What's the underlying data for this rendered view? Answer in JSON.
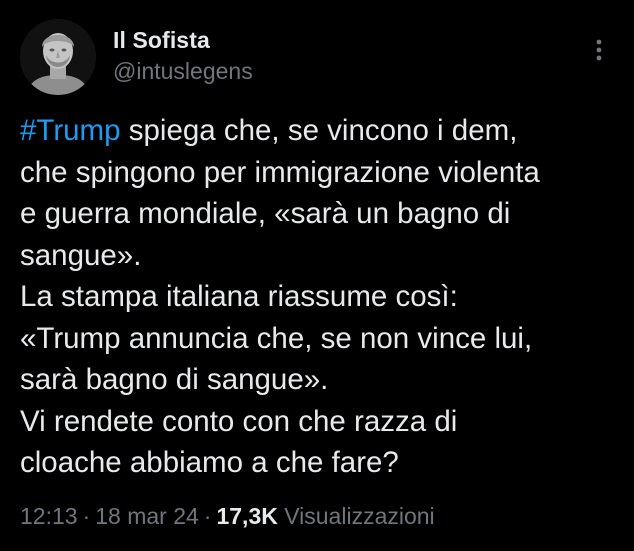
{
  "author": {
    "display_name": "Il Sofista",
    "handle": "@intuslegens",
    "avatar_icon": "bust-statue-avatar"
  },
  "tweet": {
    "hashtag": "#Trump",
    "text_after_hashtag": " spiega che, se vincono i dem,\nche spingono per immigrazione violenta\ne guerra mondiale, «sarà un bagno di\nsangue».\nLa stampa italiana riassume così:\n«Trump annuncia che, se non vince lui,\nsarà bagno di sangue».\nVi rendete conto con che razza di\ncloache abbiamo a che fare?"
  },
  "meta": {
    "time": "12:13",
    "separator": "·",
    "date": "18 mar 24",
    "views_count": "17,3K",
    "views_label": "Visualizzazioni"
  },
  "icons": {
    "more": "more-vertical-icon"
  },
  "colors": {
    "background": "#000000",
    "text": "#e7e9ea",
    "secondary": "#71767b",
    "link": "#1d9bf0"
  }
}
